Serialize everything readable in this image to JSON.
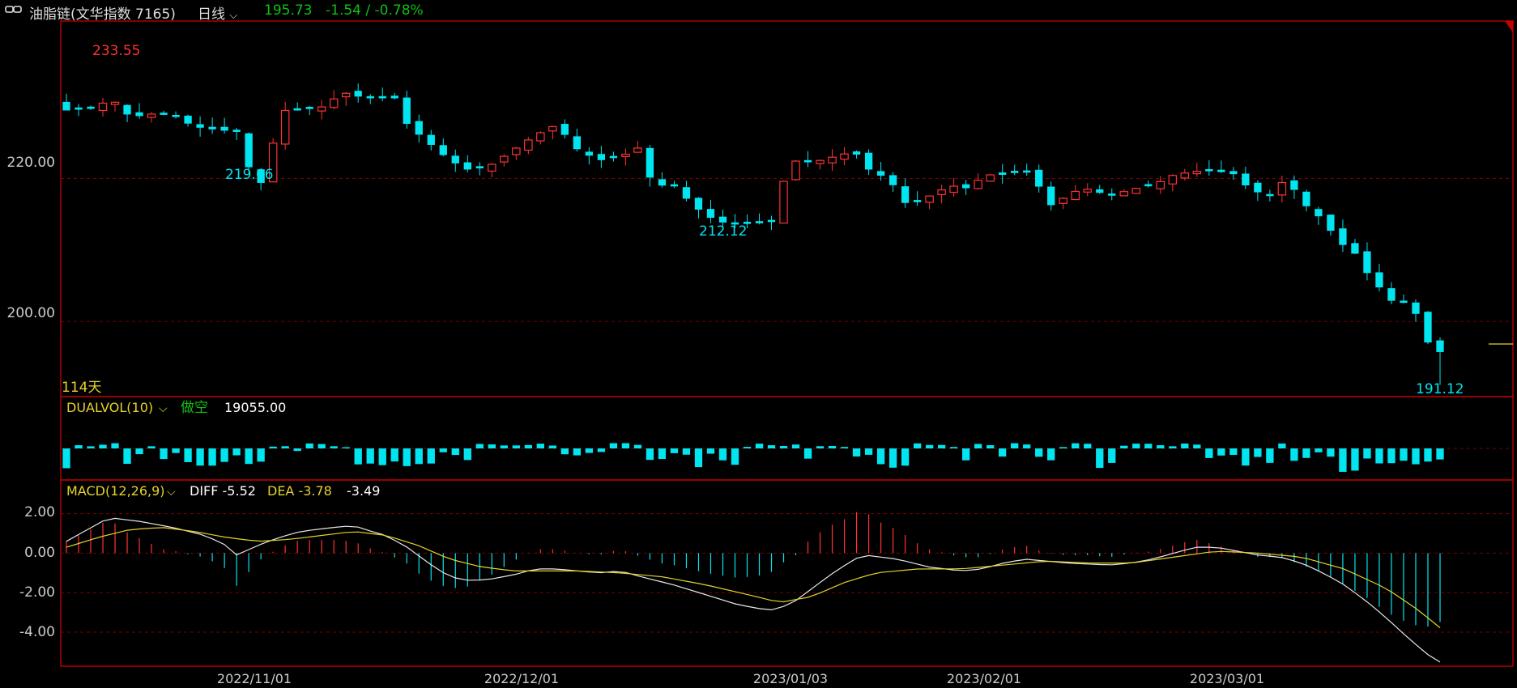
{
  "header": {
    "link_icon": "chain-link-icon",
    "title": "油脂链(文华指数 7165)",
    "period": "日线",
    "dropdown_icon": "chevron-down-icon",
    "last_price": "195.73",
    "change": "-1.54 / -0.78%"
  },
  "colors": {
    "up": "#ff3232",
    "down": "#00e5f0",
    "grid": "#7a0000",
    "frame": "#c80000",
    "label_yellow": "#e6d22c",
    "green": "#10c010"
  },
  "price_panel": {
    "y_ticks": [
      "220.00",
      "200.00"
    ],
    "high_label": "233.55",
    "low_label_1": "219.66",
    "low_label_2": "212.12",
    "low_label_3": "191.12",
    "days_label": "114天"
  },
  "volume_panel": {
    "name": "DUALVOL(10)",
    "signal": "做空",
    "value": "19055.00"
  },
  "macd_panel": {
    "name": "MACD(12,26,9)",
    "diff_label": "DIFF -5.52",
    "dea_label": "DEA -3.78",
    "macd_value": "-3.49",
    "y_ticks": [
      "2.00",
      "0.00",
      "-2.00",
      "-4.00"
    ]
  },
  "x_axis": {
    "labels": [
      "2022/11/01",
      "2022/12/01",
      "2023/01/03",
      "2023/02/01",
      "2023/03/01"
    ]
  },
  "chart_data": {
    "type": "candlestick",
    "n_bars": 114,
    "price_ylim": [
      189.5,
      242
    ],
    "price_anchors": [
      [
        0,
        229.5
      ],
      [
        3,
        229.8
      ],
      [
        4,
        231.5
      ],
      [
        6,
        228.5
      ],
      [
        8,
        229.0
      ],
      [
        10,
        228.8
      ],
      [
        12,
        227.2
      ],
      [
        14,
        226.8
      ],
      [
        16,
        226.5
      ],
      [
        17,
        222.0
      ],
      [
        18,
        218.5
      ],
      [
        19,
        221.8
      ],
      [
        20,
        229.5
      ],
      [
        22,
        229.5
      ],
      [
        24,
        230.0
      ],
      [
        26,
        232.0
      ],
      [
        28,
        231.2
      ],
      [
        31,
        231.2
      ],
      [
        32,
        227.5
      ],
      [
        34,
        225.0
      ],
      [
        36,
        222.5
      ],
      [
        38,
        221.0
      ],
      [
        40,
        222.0
      ],
      [
        42,
        224.0
      ],
      [
        44,
        226.0
      ],
      [
        46,
        227.5
      ],
      [
        48,
        224.0
      ],
      [
        50,
        222.5
      ],
      [
        52,
        223.0
      ],
      [
        54,
        224.5
      ],
      [
        55,
        219.0
      ],
      [
        57,
        219.0
      ],
      [
        59,
        216.0
      ],
      [
        61,
        214.0
      ],
      [
        63,
        213.5
      ],
      [
        65,
        213.8
      ],
      [
        66,
        212.8
      ],
      [
        67,
        218.0
      ],
      [
        68,
        222.5
      ],
      [
        70,
        222.2
      ],
      [
        72,
        223.0
      ],
      [
        74,
        223.8
      ],
      [
        75,
        221.5
      ],
      [
        77,
        220.0
      ],
      [
        78,
        218.5
      ],
      [
        79,
        216.0
      ],
      [
        81,
        217.5
      ],
      [
        83,
        219.0
      ],
      [
        85,
        218.5
      ],
      [
        86,
        220.5
      ],
      [
        88,
        220.5
      ],
      [
        90,
        221.0
      ],
      [
        91,
        220.0
      ],
      [
        92,
        216.5
      ],
      [
        93,
        216.0
      ],
      [
        94,
        218.0
      ],
      [
        96,
        218.5
      ],
      [
        98,
        217.5
      ],
      [
        100,
        218.5
      ],
      [
        102,
        219.0
      ],
      [
        104,
        220.5
      ],
      [
        106,
        221.0
      ],
      [
        108,
        221.0
      ],
      [
        110,
        220.5
      ],
      [
        111,
        218.5
      ],
      [
        113,
        217.5
      ],
      [
        114,
        219.5
      ],
      [
        115,
        219.0
      ],
      [
        116,
        217.0
      ],
      [
        117,
        215.0
      ],
      [
        118,
        214.5
      ],
      [
        119,
        212.0
      ],
      [
        120,
        210.5
      ],
      [
        121,
        209.5
      ],
      [
        122,
        207.0
      ],
      [
        123,
        205.5
      ],
      [
        124,
        203.0
      ],
      [
        126,
        202.5
      ],
      [
        127,
        200.5
      ],
      [
        128,
        196.5
      ],
      [
        129,
        195.73
      ]
    ],
    "macd_ylim": [
      -5.6,
      2.6
    ],
    "diff_anchors": [
      [
        0,
        0.6
      ],
      [
        2,
        1.2
      ],
      [
        4,
        1.8
      ],
      [
        7,
        1.6
      ],
      [
        10,
        1.3
      ],
      [
        13,
        0.9
      ],
      [
        15,
        0.4
      ],
      [
        16,
        -0.1
      ],
      [
        18,
        0.4
      ],
      [
        20,
        0.8
      ],
      [
        22,
        1.1
      ],
      [
        25,
        1.3
      ],
      [
        27,
        1.4
      ],
      [
        28,
        1.2
      ],
      [
        30,
        0.9
      ],
      [
        32,
        0.3
      ],
      [
        34,
        -0.5
      ],
      [
        36,
        -1.2
      ],
      [
        38,
        -1.4
      ],
      [
        40,
        -1.3
      ],
      [
        42,
        -1.1
      ],
      [
        44,
        -0.8
      ],
      [
        46,
        -0.8
      ],
      [
        48,
        -0.9
      ],
      [
        50,
        -1.0
      ],
      [
        52,
        -0.9
      ],
      [
        54,
        -1.2
      ],
      [
        57,
        -1.6
      ],
      [
        60,
        -2.1
      ],
      [
        63,
        -2.6
      ],
      [
        66,
        -2.9
      ],
      [
        68,
        -2.6
      ],
      [
        70,
        -1.8
      ],
      [
        72,
        -1.0
      ],
      [
        74,
        -0.3
      ],
      [
        75,
        -0.1
      ],
      [
        78,
        -0.3
      ],
      [
        81,
        -0.7
      ],
      [
        84,
        -0.9
      ],
      [
        86,
        -0.8
      ],
      [
        88,
        -0.5
      ],
      [
        90,
        -0.3
      ],
      [
        92,
        -0.4
      ],
      [
        94,
        -0.5
      ],
      [
        98,
        -0.6
      ],
      [
        100,
        -0.5
      ],
      [
        102,
        -0.3
      ],
      [
        104,
        0.0
      ],
      [
        106,
        0.3
      ],
      [
        108,
        0.3
      ],
      [
        110,
        0.1
      ],
      [
        112,
        -0.1
      ],
      [
        114,
        -0.2
      ],
      [
        116,
        -0.5
      ],
      [
        118,
        -1.0
      ],
      [
        120,
        -1.6
      ],
      [
        122,
        -2.4
      ],
      [
        124,
        -3.3
      ],
      [
        126,
        -4.3
      ],
      [
        128,
        -5.2
      ],
      [
        129,
        -5.52
      ]
    ],
    "dea_anchors": [
      [
        0,
        0.3
      ],
      [
        3,
        0.8
      ],
      [
        6,
        1.2
      ],
      [
        9,
        1.3
      ],
      [
        12,
        1.1
      ],
      [
        15,
        0.8
      ],
      [
        18,
        0.6
      ],
      [
        21,
        0.7
      ],
      [
        24,
        0.9
      ],
      [
        27,
        1.1
      ],
      [
        30,
        0.9
      ],
      [
        33,
        0.4
      ],
      [
        36,
        -0.3
      ],
      [
        39,
        -0.7
      ],
      [
        42,
        -0.9
      ],
      [
        45,
        -0.9
      ],
      [
        48,
        -0.9
      ],
      [
        52,
        -1.0
      ],
      [
        56,
        -1.2
      ],
      [
        60,
        -1.6
      ],
      [
        64,
        -2.1
      ],
      [
        67,
        -2.5
      ],
      [
        70,
        -2.2
      ],
      [
        73,
        -1.5
      ],
      [
        76,
        -1.0
      ],
      [
        80,
        -0.8
      ],
      [
        84,
        -0.8
      ],
      [
        88,
        -0.6
      ],
      [
        92,
        -0.4
      ],
      [
        96,
        -0.5
      ],
      [
        100,
        -0.5
      ],
      [
        104,
        -0.2
      ],
      [
        108,
        0.1
      ],
      [
        112,
        0.0
      ],
      [
        116,
        -0.2
      ],
      [
        120,
        -0.8
      ],
      [
        124,
        -1.8
      ],
      [
        127,
        -2.9
      ],
      [
        129,
        -3.78
      ]
    ],
    "dualvol_value": 19055.0,
    "vol_signal": "做空"
  }
}
